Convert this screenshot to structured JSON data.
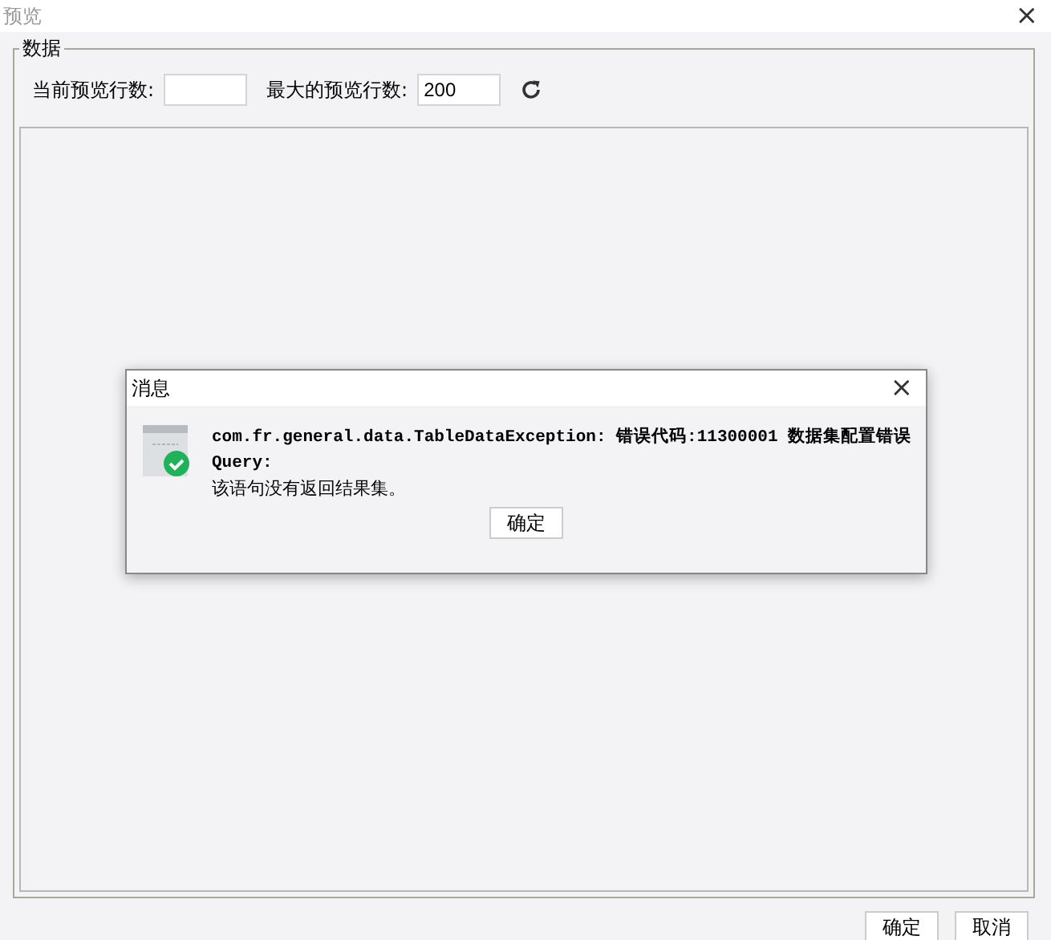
{
  "window": {
    "title": "预览",
    "close": "×"
  },
  "group": {
    "legend": "数据",
    "current_rows_label": "当前预览行数:",
    "max_rows_label": "最大的预览行数:",
    "max_rows_value": "200"
  },
  "message_dialog": {
    "title": "消息",
    "close": "×",
    "lines": [
      {
        "kind": "code",
        "text": "com.fr.general.data.TableDataException: 错误代码:11300001 数据集配置错误"
      },
      {
        "kind": "code",
        "text": "Query:"
      },
      {
        "kind": "plain",
        "text": "该语句没有返回结果集。"
      }
    ],
    "button": "确定"
  },
  "buttons": [
    "确定",
    "取消"
  ]
}
